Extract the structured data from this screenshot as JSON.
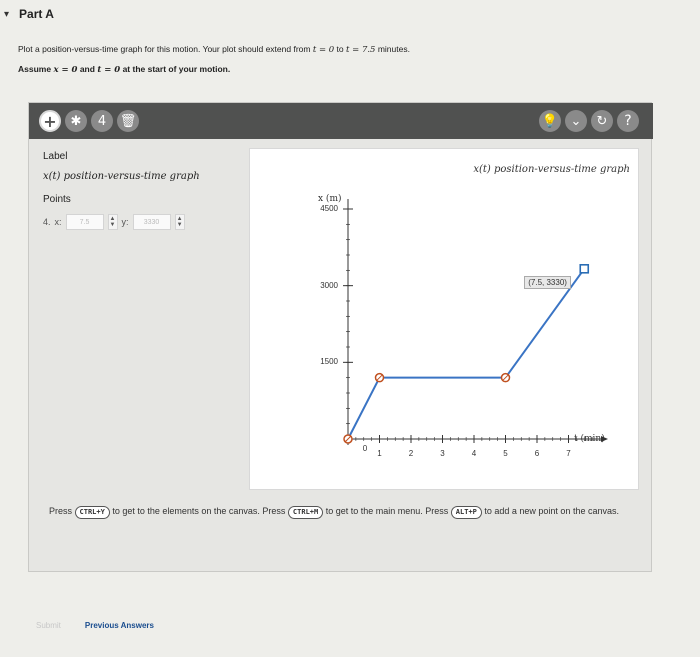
{
  "part": {
    "title": "Part A",
    "caret": "▾"
  },
  "instructions": {
    "line1_a": "Plot a position-versus-time graph for this motion. Your plot should extend from ",
    "line1_t0": "t = 0",
    "line1_b": " to ",
    "line1_t1": "t = 7.5",
    "line1_c": " minutes.",
    "line2_a": "Assume ",
    "line2_x0": "x = 0",
    "line2_b": " and ",
    "line2_t0": "t = 0",
    "line2_c": " at the start of your motion."
  },
  "toolbar": {
    "left_tools": [
      {
        "name": "add-point-tool",
        "glyph": "+"
      },
      {
        "name": "edit-tool",
        "glyph": "✱"
      },
      {
        "name": "move-tool",
        "glyph": "4"
      },
      {
        "name": "delete-tool",
        "glyph": "🗑"
      }
    ],
    "right_tools": [
      {
        "name": "hint-tool",
        "glyph": "💡"
      },
      {
        "name": "dropdown-tool",
        "glyph": "⌄"
      },
      {
        "name": "reset-tool",
        "glyph": "↻"
      },
      {
        "name": "help-tool",
        "glyph": "?"
      }
    ]
  },
  "side": {
    "label_heading": "Label",
    "label_value": "x(t) position-versus-time graph",
    "points_heading": "Points",
    "point_index": "4.",
    "x_label": "x:",
    "x_value": "7.5",
    "y_label": "y:",
    "y_value": "3330"
  },
  "chart_data": {
    "type": "line",
    "title": "x(t) position-versus-time graph",
    "ylabel": "x (m)",
    "xlabel": "t (min)",
    "yticks": [
      "4500",
      "3000",
      "1500"
    ],
    "ytick_values": [
      4500,
      3000,
      1500
    ],
    "xticks": [
      "1",
      "2",
      "3",
      "4",
      "5",
      "6",
      "7"
    ],
    "xtick_values": [
      1,
      2,
      3,
      4,
      5,
      6,
      7
    ],
    "origin_label": "0",
    "xlim": [
      0,
      8
    ],
    "ylim": [
      0,
      4500
    ],
    "x": [
      0,
      1,
      5,
      7.5
    ],
    "y": [
      0,
      1200,
      1200,
      3330
    ],
    "highlight_label": "(7.5, 3330)"
  },
  "press_text": {
    "a": "Press ",
    "k1": "CTRL+Y",
    "b": " to get to the elements on the canvas. Press ",
    "k2": "CTRL+M",
    "c": " to get to the main menu. Press ",
    "k3": "ALT+P",
    "d": " to add a new point on the canvas."
  },
  "bottom": {
    "submit": "Submit",
    "previous": "Previous Answers"
  }
}
